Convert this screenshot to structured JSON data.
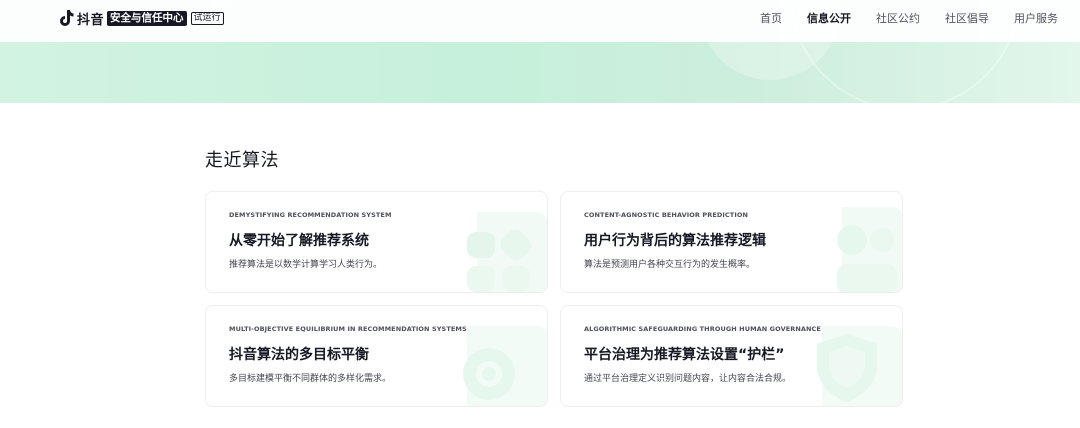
{
  "header": {
    "brand": "抖音",
    "center_label": "安全与信任中心",
    "trial_badge": "试运行",
    "nav": [
      {
        "label": "首页",
        "active": false
      },
      {
        "label": "信息公开",
        "active": true
      },
      {
        "label": "社区公约",
        "active": false
      },
      {
        "label": "社区倡导",
        "active": false
      },
      {
        "label": "用户服务",
        "active": false
      }
    ]
  },
  "main": {
    "section_title": "走近算法",
    "cards": [
      {
        "subtitle": "DEMYSTIFYING RECOMMENDATION SYSTEM",
        "title": "从零开始了解推荐系统",
        "description": "推荐算法是以数学计算学习人类行为。"
      },
      {
        "subtitle": "CONTENT-AGNOSTIC BEHAVIOR PREDICTION",
        "title": "用户行为背后的算法推荐逻辑",
        "description": "算法是预测用户各种交互行为的发生概率。"
      },
      {
        "subtitle": "MULTI-OBJECTIVE EQUILIBRIUM IN RECOMMENDATION SYSTEMS",
        "title": "抖音算法的多目标平衡",
        "description": "多目标建模平衡不同群体的多样化需求。"
      },
      {
        "subtitle": "ALGORITHMIC SAFEGUARDING THROUGH HUMAN GOVERNANCE",
        "title": "平台治理为推荐算法设置“护栏”",
        "description": "通过平台治理定义识别问题内容，让内容合法合规。"
      }
    ]
  },
  "colors": {
    "hero_green": "#c6f0db",
    "text_primary": "#161823",
    "text_secondary": "#505361",
    "card_border": "#eeeeef",
    "deco_green": "#d8f4e6"
  }
}
